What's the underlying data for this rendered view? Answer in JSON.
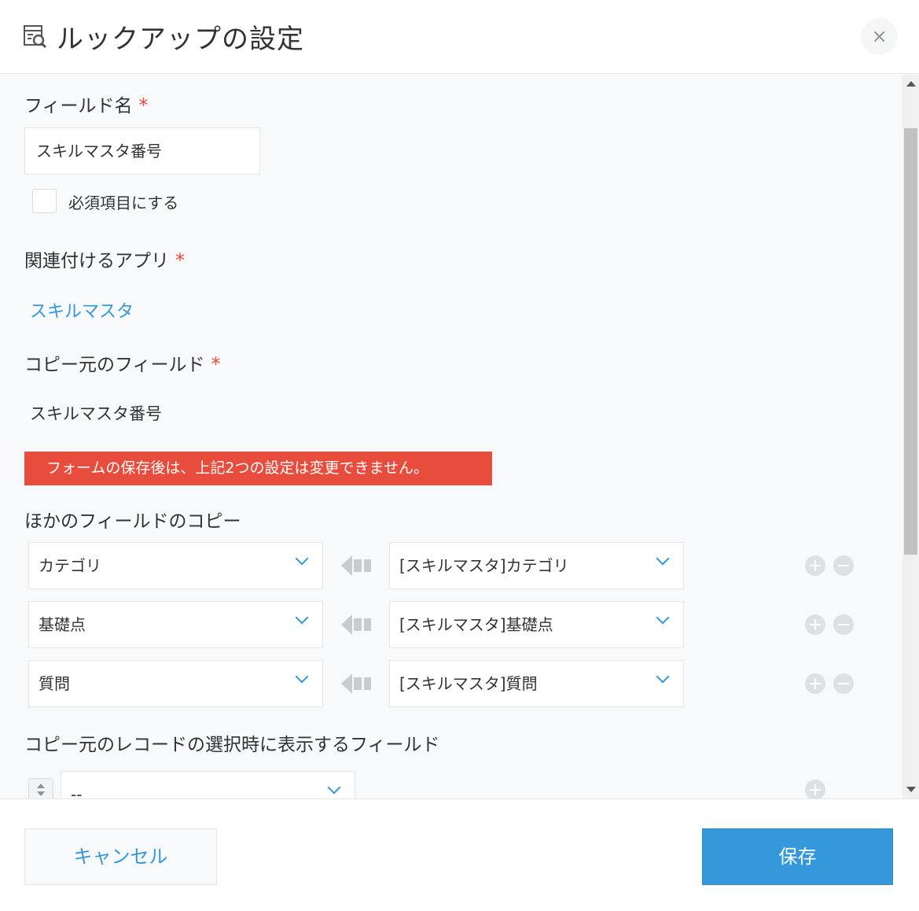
{
  "header": {
    "title": "ルックアップの設定",
    "icon": "lookup-icon",
    "close_label": "×"
  },
  "form": {
    "field_name_label": "フィールド名",
    "required_mark": "*",
    "field_name_value": "スキルマスタ番号",
    "required_checkbox_label": "必須項目にする",
    "required_checked": false,
    "related_app_label": "関連付けるアプリ",
    "related_app_value": "スキルマスタ",
    "source_field_label": "コピー元のフィールド",
    "source_field_value": "スキルマスタ番号",
    "warning_text": "フォームの保存後は、上記2つの設定は変更できません。",
    "copy_other_label": "ほかのフィールドのコピー",
    "copy_rows": [
      {
        "target": "カテゴリ",
        "source": "[スキルマスタ]カテゴリ"
      },
      {
        "target": "基礎点",
        "source": "[スキルマスタ]基礎点"
      },
      {
        "target": "質問",
        "source": "[スキルマスタ]質問"
      }
    ],
    "display_fields_label": "コピー元のレコードの選択時に表示するフィールド",
    "display_fields_value": "--"
  },
  "footer": {
    "cancel_label": "キャンセル",
    "save_label": "保存"
  },
  "colors": {
    "accent": "#3498db",
    "warning": "#e74c3c",
    "required": "#e74c3c"
  }
}
